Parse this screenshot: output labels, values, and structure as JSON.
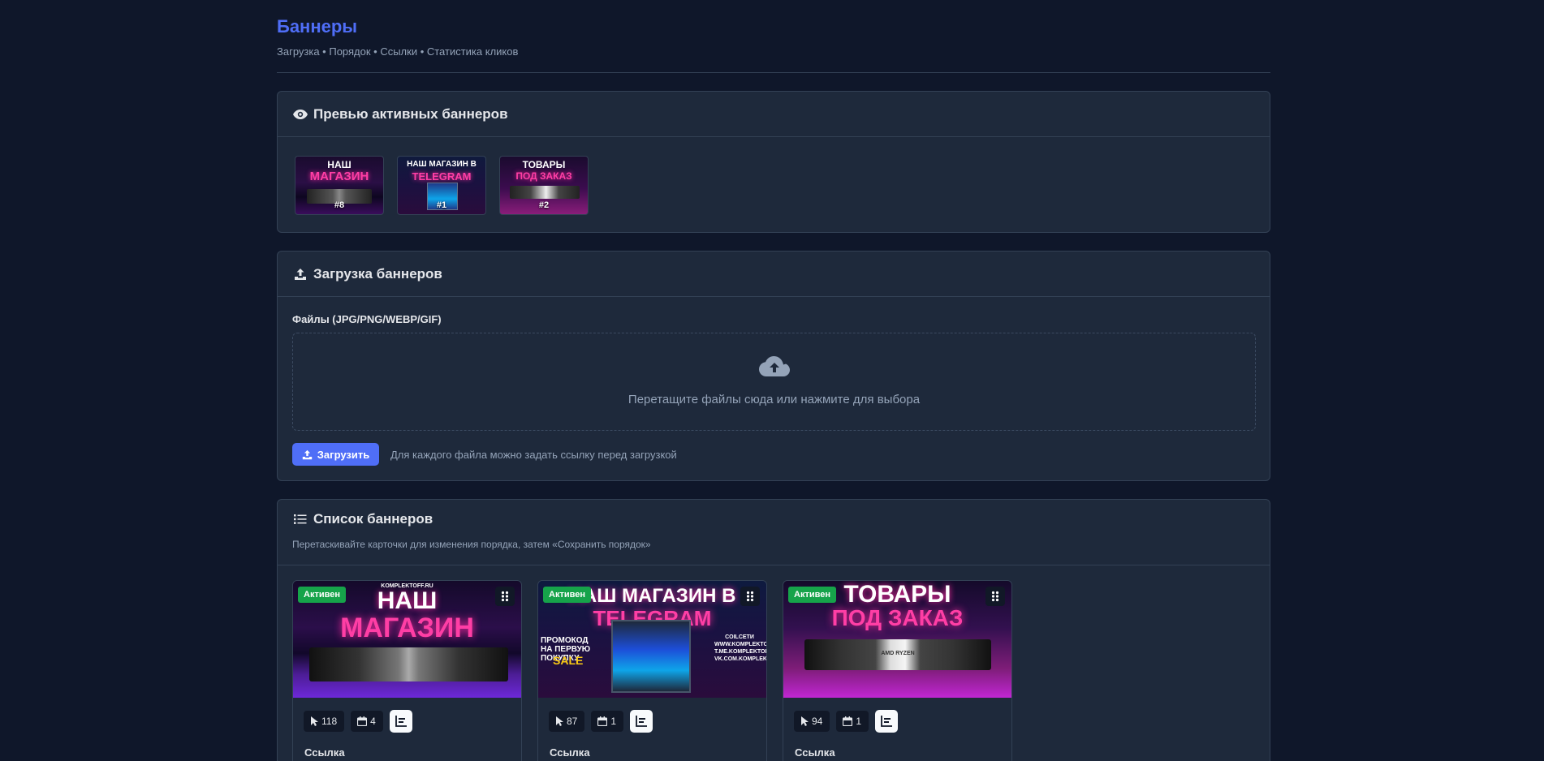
{
  "header": {
    "title": "Баннеры",
    "subtitle": "Загрузка • Порядок • Ссылки • Статистика кликов"
  },
  "preview": {
    "title": "Превью активных баннеров",
    "icon": "eye-icon",
    "thumbs": [
      {
        "label": "#8",
        "top": "НАШ",
        "mid": "МАГАЗИН"
      },
      {
        "label": "#1",
        "top": "НАШ МАГАЗИН В",
        "mid": "TELEGRAM"
      },
      {
        "label": "#2",
        "top": "ТОВАРЫ",
        "mid": "ПОД ЗАКАЗ"
      }
    ]
  },
  "upload": {
    "title": "Загрузка баннеров",
    "icon": "upload-icon",
    "files_label": "Файлы (JPG/PNG/WEBP/GIF)",
    "dropzone_text": "Перетащите файлы сюда или нажмите для выбора",
    "button_label": "Загрузить",
    "hint": "Для каждого файла можно задать ссылку перед загрузкой"
  },
  "list": {
    "title": "Список баннеров",
    "icon": "list-icon",
    "subtitle": "Перетаскивайте карточки для изменения порядка, затем «Сохранить порядок»",
    "cards": [
      {
        "status": "Активен",
        "clicks": "118",
        "days": "4",
        "link_label": "Ссылка",
        "site": "KOMPLEKTOFF.RU",
        "top": "НАШ",
        "mid": "МАГАЗИН"
      },
      {
        "status": "Активен",
        "clicks": "87",
        "days": "1",
        "link_label": "Ссылка",
        "top": "НАШ МАГАЗИН В",
        "mid": "TELEGRAM",
        "promo": "ПРОМОКОД НА ПЕРВУЮ ПОКУПКУ",
        "sale": "SALE",
        "right_text": "COILCETИ WWW.KOMPLEKTOFF.RU T.ME.KOMPLEKTOFF VK.COM.KOMPLEKTOFF"
      },
      {
        "status": "Активен",
        "clicks": "94",
        "days": "1",
        "link_label": "Ссылка",
        "top": "ТОВАРЫ",
        "mid": "ПОД ЗАКАЗ",
        "chip_text": "AMD RYZEN"
      }
    ]
  },
  "colors": {
    "background": "#0f172a",
    "panel": "#1e293b",
    "accent": "#4f6ef7",
    "active": "#16a34a",
    "neon": "#ff3ea5"
  }
}
